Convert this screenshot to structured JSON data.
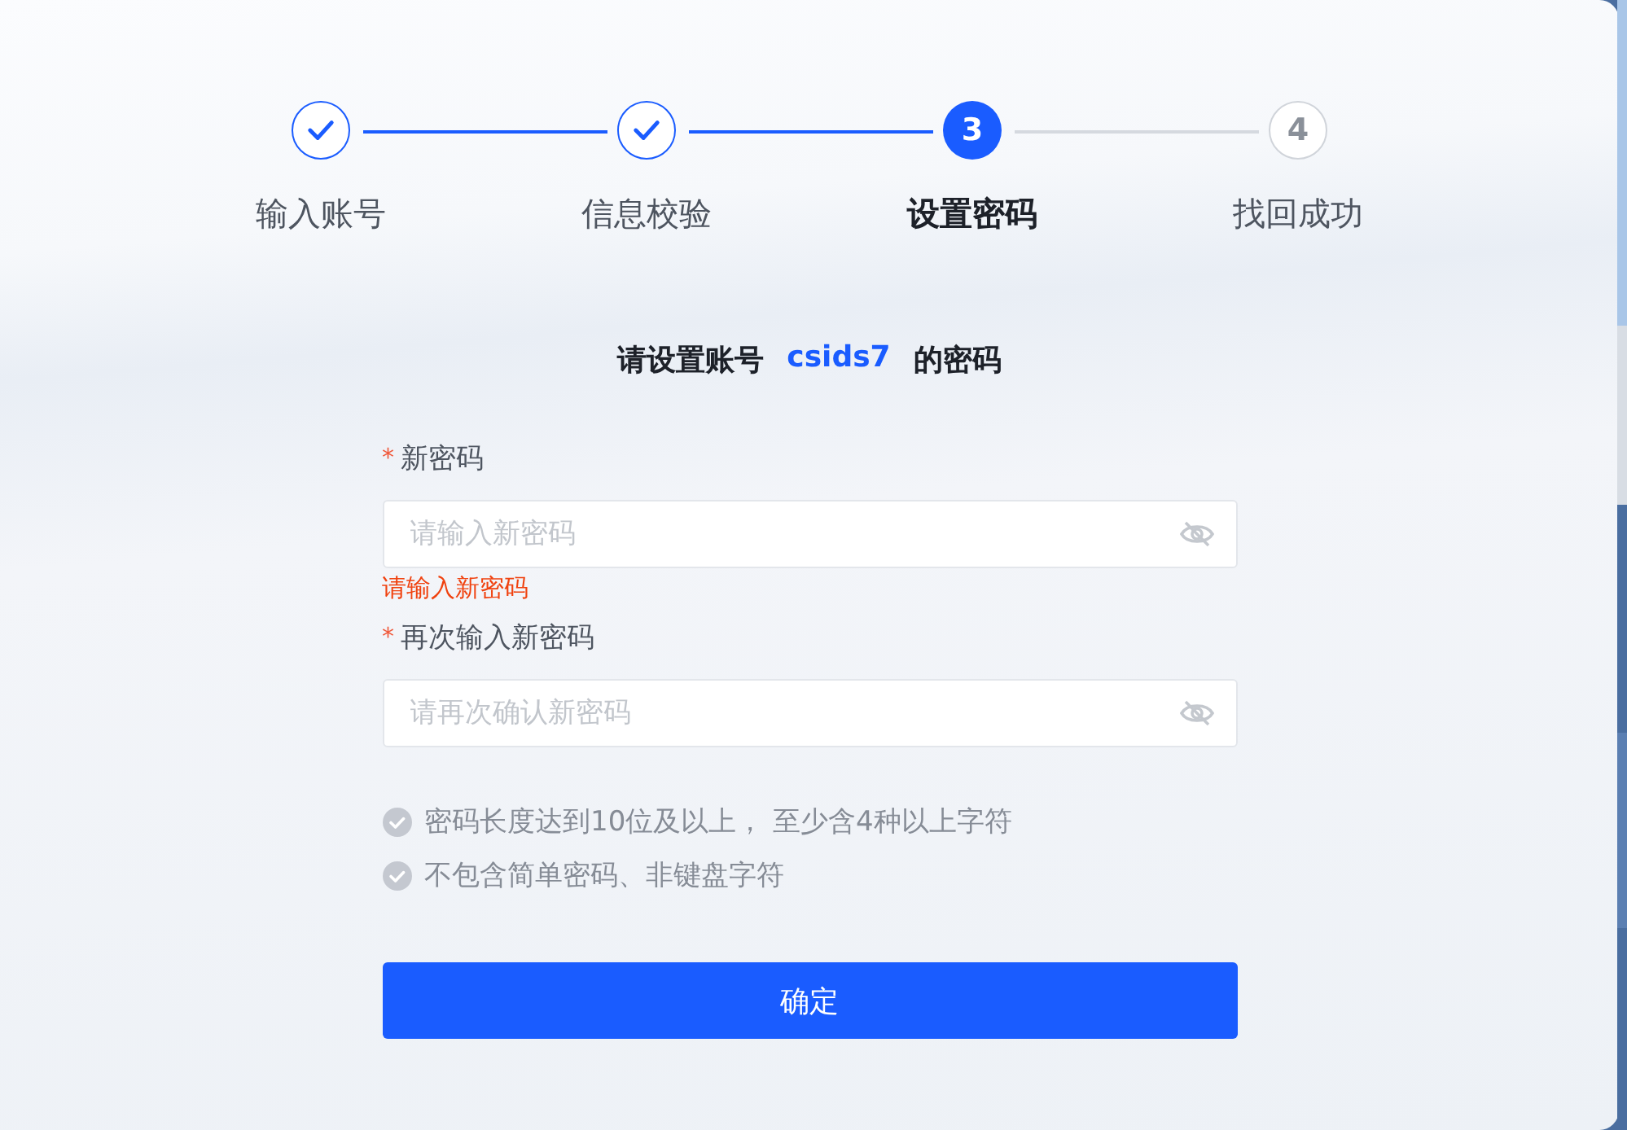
{
  "steps": [
    {
      "label": "输入账号",
      "done": true,
      "selected": false
    },
    {
      "label": "信息校验",
      "done": true,
      "selected": false
    },
    {
      "label": "设置密码",
      "done": false,
      "selected": true,
      "number": "3"
    },
    {
      "label": "找回成功",
      "done": false,
      "selected": false,
      "number": "4"
    }
  ],
  "heading": {
    "prefix": "请设置账号",
    "account": "csids7",
    "suffix": "的密码"
  },
  "fields": [
    {
      "marker": "*",
      "label": "新密码",
      "placeholder": "请输入新密码",
      "masked": true,
      "error": "请输入新密码"
    },
    {
      "marker": "*",
      "label": "再次输入新密码",
      "placeholder": "请再次确认新密码",
      "masked": true
    }
  ],
  "rules": [
    {
      "text": "密码长度达到10位及以上， 至少含4种以上字符",
      "met": false
    },
    {
      "text": "不包含简单密码、非键盘字符",
      "met": false
    }
  ],
  "submit": "确定"
}
